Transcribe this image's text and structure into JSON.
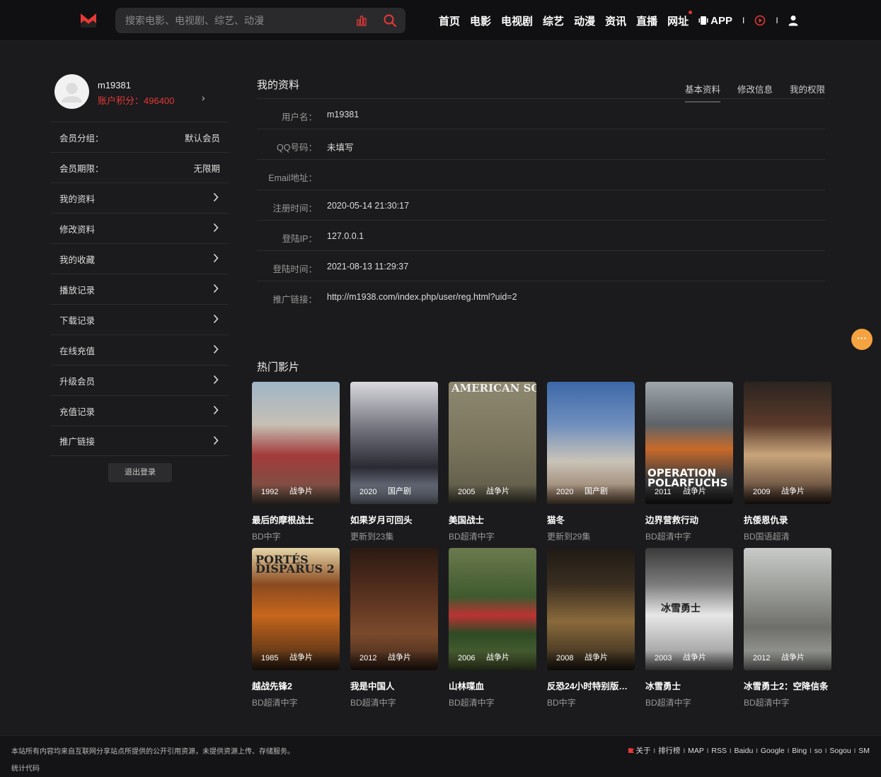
{
  "header": {
    "search_placeholder": "搜索电影、电视剧、综艺、动漫",
    "nav": [
      "首页",
      "电影",
      "电视剧",
      "综艺",
      "动漫",
      "资讯",
      "直播",
      "网址"
    ],
    "app_label": "APP",
    "sep": "I"
  },
  "sidebar": {
    "username": "m19381",
    "points": "账户积分：496400",
    "chevron": "›",
    "group_label": "会员分组：",
    "group_value": "默认会员",
    "expire_label": "会员期限：",
    "expire_value": "无限期",
    "menu": [
      "我的资料",
      "修改资料",
      "我的收藏",
      "播放记录",
      "下载记录",
      "在线充值",
      "升级会员",
      "充值记录",
      "推广链接"
    ],
    "logout": "退出登录"
  },
  "profile": {
    "title": "我的资料",
    "tabs": [
      "基本资料",
      "修改信息",
      "我的权限"
    ],
    "rows": [
      {
        "k": "用户名：",
        "v": "m19381"
      },
      {
        "k": "QQ号码：",
        "v": "未填写"
      },
      {
        "k": "Email地址：",
        "v": ""
      },
      {
        "k": "注册时间：",
        "v": "2020-05-14 21:30:17"
      },
      {
        "k": "登陆IP：",
        "v": "127.0.0.1"
      },
      {
        "k": "登陆时间：",
        "v": "2021-08-13 11:29:37"
      },
      {
        "k": "推广链接：",
        "v": "http://m1938.com/index.php/user/reg.html?uid=2"
      }
    ]
  },
  "hot": {
    "title": "热门影片",
    "movies": [
      {
        "title": "最后的摩根战士",
        "sub": "BD中字",
        "year": "1992",
        "genre": "战争片",
        "poster_text": ""
      },
      {
        "title": "如果岁月可回头",
        "sub": "更新到23集",
        "year": "2020",
        "genre": "国产剧",
        "poster_text": ""
      },
      {
        "title": "美国战士",
        "sub": "BD超清中字",
        "year": "2005",
        "genre": "战争片",
        "poster_text": "AMERICAN SOLDIERS"
      },
      {
        "title": "猫冬",
        "sub": "更新到29集",
        "year": "2020",
        "genre": "国产剧",
        "poster_text": ""
      },
      {
        "title": "边界营救行动",
        "sub": "BD超清中字",
        "year": "2011",
        "genre": "战争片",
        "poster_text": "OPERATION POLARFUCHS"
      },
      {
        "title": "抗倭恩仇录",
        "sub": "BD国语超清",
        "year": "2009",
        "genre": "战争片",
        "poster_text": ""
      },
      {
        "title": "越战先锋2",
        "sub": "BD超清中字",
        "year": "1985",
        "genre": "战争片",
        "poster_text": "PORTÉS DISPARUS 2"
      },
      {
        "title": "我是中国人",
        "sub": "BD超清中字",
        "year": "2012",
        "genre": "战争片",
        "poster_text": ""
      },
      {
        "title": "山林喋血",
        "sub": "BD超清中字",
        "year": "2006",
        "genre": "战争片",
        "poster_text": ""
      },
      {
        "title": "反恐24小时特别版：…",
        "sub": "BD中字",
        "year": "2008",
        "genre": "战争片",
        "poster_text": ""
      },
      {
        "title": "冰雪勇士",
        "sub": "BD超清中字",
        "year": "2003",
        "genre": "战争片",
        "poster_text": "冰雪勇士"
      },
      {
        "title": "冰雪勇士2：空降信条",
        "sub": "BD超清中字",
        "year": "2012",
        "genre": "战争片",
        "poster_text": ""
      }
    ]
  },
  "footer": {
    "notice": "本站所有内容均来自互联网分享站点所提供的公开引用资源，未提供资源上传、存储服务。",
    "stat": "统计代码",
    "links": [
      "关于",
      "排行榜",
      "MAP",
      "RSS",
      "Baidu",
      "Google",
      "Bing",
      "so",
      "Sogou",
      "SM"
    ]
  },
  "colors": {
    "accent_red": "#e53935",
    "float_orange": "#f4a340"
  }
}
